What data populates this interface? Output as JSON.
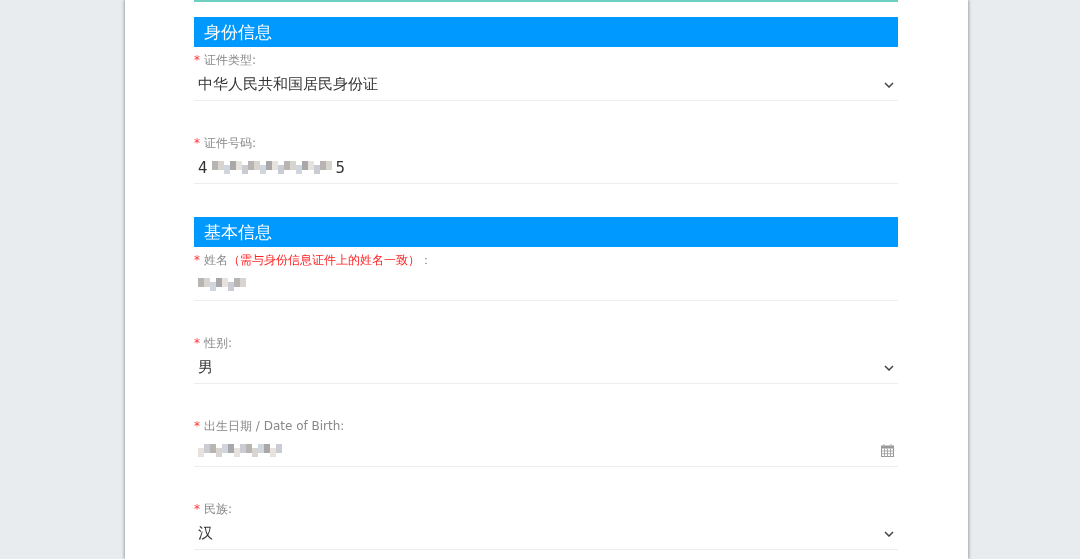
{
  "sections": [
    {
      "title": "身份信息",
      "fields": [
        {
          "kind": "select",
          "required_mark": "*",
          "label": "证件类型:",
          "value": "中华人民共和国居民身份证",
          "redacted": false
        },
        {
          "kind": "text",
          "required_mark": "*",
          "label": "证件号码:",
          "value_start": "4",
          "value_end": "5",
          "redacted": true
        }
      ]
    },
    {
      "title": "基本信息",
      "fields": [
        {
          "kind": "text",
          "required_mark": "*",
          "label": "姓名",
          "hint": "（需与身份信息证件上的姓名一致）",
          "label_end": "：",
          "redacted": true
        },
        {
          "kind": "select",
          "required_mark": "*",
          "label": "性别:",
          "value": "男",
          "redacted": false
        },
        {
          "kind": "date",
          "required_mark": "*",
          "label": "出生日期 / Date of Birth:",
          "redacted": true
        },
        {
          "kind": "select",
          "required_mark": "*",
          "label": "民族:",
          "value": "汉",
          "redacted": false
        }
      ]
    }
  ]
}
